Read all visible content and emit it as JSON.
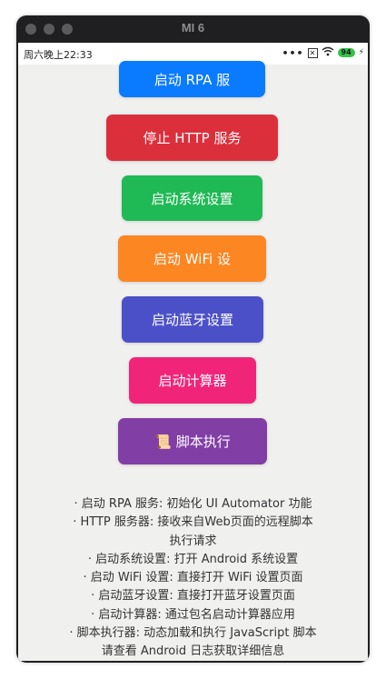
{
  "window": {
    "title": "MI 6"
  },
  "statusbar": {
    "time": "周六晚上22:33",
    "dots": "•••",
    "battery": "94",
    "sim": "✕",
    "charging": "⚡"
  },
  "buttons": [
    {
      "label": "启动 RPA 服",
      "color": "#0a7bff"
    },
    {
      "label": "停止 HTTP 服务",
      "color": "#dc2f3c"
    },
    {
      "label": "启动系统设置",
      "color": "#1fb955"
    },
    {
      "label": "启动 WiFi 设",
      "color": "#fc8622"
    },
    {
      "label": "启动蓝牙设置",
      "color": "#4c50c8"
    },
    {
      "label": "启动计算器",
      "color": "#f0257a"
    },
    {
      "label": "📜 脚本执行",
      "color": "#813ea5"
    }
  ],
  "notes": [
    "· 启动 RPA 服务: 初始化 UI Automator 功能",
    "· HTTP 服务器: 接收来自Web页面的远程脚本",
    "执行请求",
    "· 启动系统设置: 打开 Android 系统设置",
    "· 启动 WiFi 设置: 直接打开 WiFi 设置页面",
    "· 启动蓝牙设置: 直接打开蓝牙设置页面",
    "· 启动计算器: 通过包名启动计算器应用",
    "· 脚本执行器: 动态加载和执行 JavaScript 脚本",
    "请查看 Android 日志获取详细信息"
  ]
}
